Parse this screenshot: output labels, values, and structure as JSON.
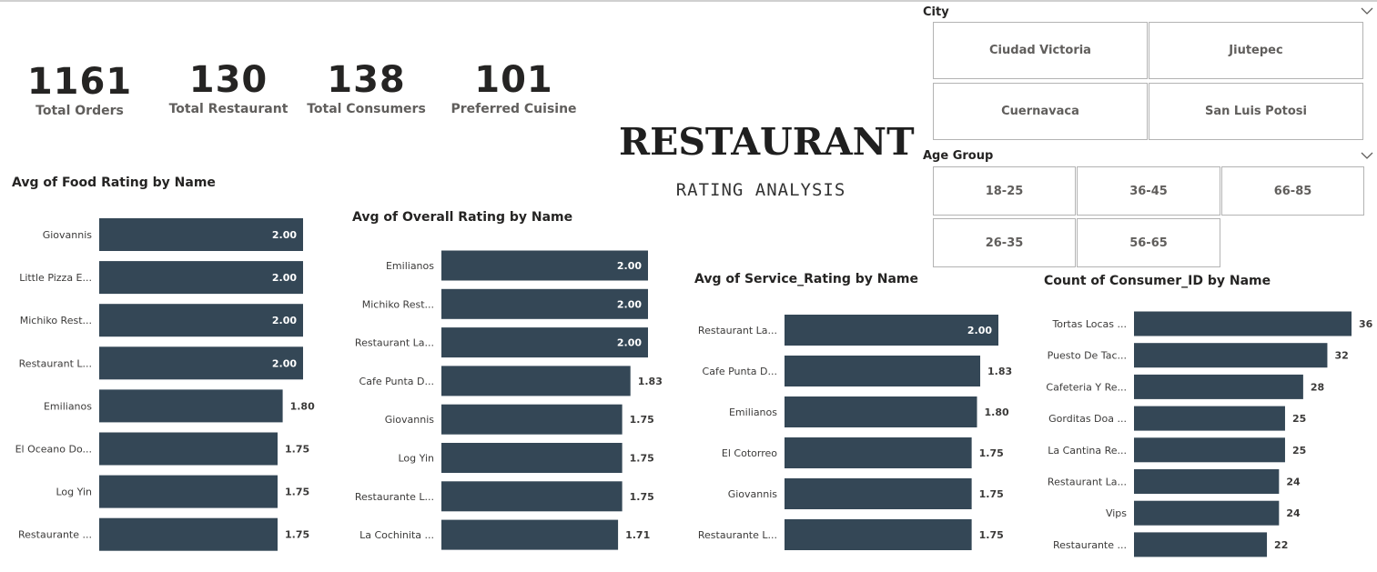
{
  "kpis": [
    {
      "value": "1161",
      "label": "Total Orders"
    },
    {
      "value": "130",
      "label": "Total Restaurant"
    },
    {
      "value": "138",
      "label": "Total Consumers"
    },
    {
      "value": "101",
      "label": "Preferred Cuisine"
    }
  ],
  "header": {
    "title": "RESTAURANT",
    "subtitle": "RATING ANALYSIS"
  },
  "slicers": {
    "city": {
      "title": "City",
      "options": [
        "Ciudad Victoria",
        "Jiutepec",
        "Cuernavaca",
        "San Luis Potosi"
      ]
    },
    "age_group": {
      "title": "Age Group",
      "options": [
        "18-25",
        "36-45",
        "66-85",
        "26-35",
        "56-65"
      ]
    }
  },
  "colors": {
    "bar": "#344756",
    "text": "#252423",
    "muted": "#605e5c"
  },
  "icons": {
    "dropdown": "chevron-down-icon"
  },
  "chart_data": [
    {
      "type": "bar",
      "orientation": "horizontal",
      "title": "Avg of Food Rating by Name",
      "categories": [
        "Giovannis",
        "Little Pizza E...",
        "Michiko Rest...",
        "Restaurant L...",
        "Emilianos",
        "El Oceano Do...",
        "Log Yin",
        "Restaurante ..."
      ],
      "values": [
        2.0,
        2.0,
        2.0,
        2.0,
        1.8,
        1.75,
        1.75,
        1.75
      ],
      "labels": [
        "2.00",
        "2.00",
        "2.00",
        "2.00",
        "1.80",
        "1.75",
        "1.75",
        "1.75"
      ],
      "xlim": [
        0,
        2.0
      ]
    },
    {
      "type": "bar",
      "orientation": "horizontal",
      "title": "Avg of Overall Rating by Name",
      "categories": [
        "Emilianos",
        "Michiko Rest...",
        "Restaurant La...",
        "Cafe Punta D...",
        "Giovannis",
        "Log Yin",
        "Restaurante L...",
        "La Cochinita ..."
      ],
      "values": [
        2.0,
        2.0,
        2.0,
        1.83,
        1.75,
        1.75,
        1.75,
        1.71
      ],
      "labels": [
        "2.00",
        "2.00",
        "2.00",
        "1.83",
        "1.75",
        "1.75",
        "1.75",
        "1.71"
      ],
      "xlim": [
        0,
        2.0
      ]
    },
    {
      "type": "bar",
      "orientation": "horizontal",
      "title": "Avg of Service_Rating by Name",
      "categories": [
        "Restaurant La...",
        "Cafe Punta D...",
        "Emilianos",
        "El Cotorreo",
        "Giovannis",
        "Restaurante L..."
      ],
      "values": [
        2.0,
        1.83,
        1.8,
        1.75,
        1.75,
        1.75
      ],
      "labels": [
        "2.00",
        "1.83",
        "1.80",
        "1.75",
        "1.75",
        "1.75"
      ],
      "xlim": [
        0,
        2.0
      ]
    },
    {
      "type": "bar",
      "orientation": "horizontal",
      "title": "Count of Consumer_ID by Name",
      "categories": [
        "Tortas Locas ...",
        "Puesto De Tac...",
        "Cafeteria Y Re...",
        "Gorditas Doa ...",
        "La Cantina Re...",
        "Restaurant La...",
        "Vips",
        "Restaurante ..."
      ],
      "values": [
        36,
        32,
        28,
        25,
        25,
        24,
        24,
        22
      ],
      "labels": [
        "36",
        "32",
        "28",
        "25",
        "25",
        "24",
        "24",
        "22"
      ],
      "xlim": [
        0,
        36
      ]
    }
  ]
}
